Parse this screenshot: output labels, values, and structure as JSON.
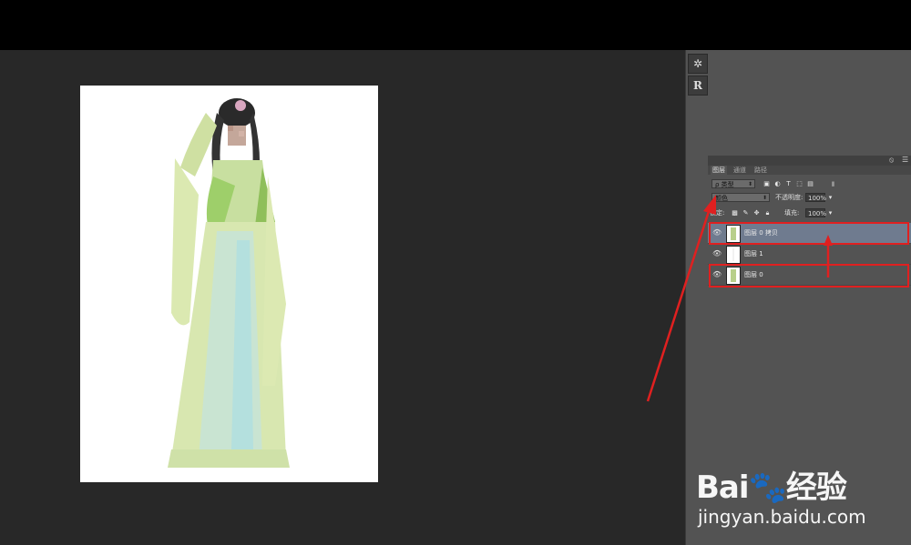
{
  "panel": {
    "tabs": [
      "图层",
      "通道",
      "路径"
    ],
    "filter": "ρ 类型",
    "blend_mode": "颜色",
    "opacity_label": "不透明度:",
    "opacity_value": "100%",
    "lock_label": "锁定:",
    "fill_label": "填充:",
    "fill_value": "100%",
    "layers": [
      {
        "name": "图层 0 拷贝",
        "selected": true
      },
      {
        "name": "图层 1",
        "selected": false
      },
      {
        "name": "图层 0",
        "selected": false
      }
    ]
  },
  "iconstrip": {
    "btn1": "✲",
    "btn2": "R"
  },
  "watermark": {
    "main": "Bai🐾经验",
    "sub": "jingyan.baidu.com"
  },
  "colors": {
    "annotation_red": "#e02020",
    "selected_layer": "#6f7b8f"
  }
}
